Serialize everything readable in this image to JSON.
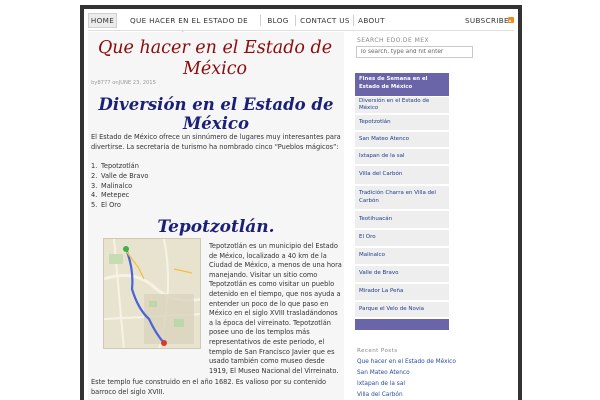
{
  "nav": {
    "items": [
      "Home",
      "Que hacer en el Estado de México",
      "Blog",
      "Contact us",
      "About"
    ],
    "subscribe": "Subscribe"
  },
  "post": {
    "title": "Que hacer en el Estado de México",
    "meta": "by8777 onJUNE 23, 2015",
    "heading": "Diversión en el Estado de México",
    "intro": "El Estado de México ofrece un sinnúmero de lugares muy interesantes para divertirse. La secretaria de turismo ha nombrado cinco “Pueblos mágicos”:",
    "list": [
      "Tepotzotlán",
      "Valle de Bravo",
      "Malinalco",
      "Metepec",
      "El Oro"
    ],
    "subheading": "Tepotzotlán.",
    "para": "Tepotzotlán es un municipio del Estado de México, localizado a 40 km de la Ciudad de México, a menos de una hora manejando. Visitar un sitio como Tepotzotlán es como visitar un pueblo detenido en el tiempo, que nos ayuda a entender un poco de lo que paso en México en el siglo XVIII trasladándonos a la época del virreinato. Tepotzotlán posee uno de los templos más representativos de este periodo, el templo de San Francisco Javier que es usado también como museo desde 1919, El Museo Nacional del Virreinato.",
    "para2": "Este templo fue construido en el año 1682. Es valioso por su contenido barroco del siglo XVIII."
  },
  "sidebar": {
    "search_label": "Search Edo.de Mex",
    "search_placeholder": "To search, type and hit enter",
    "menu_header": "Fines de Semana en el Estado de México",
    "menu_items": [
      "Diversión en el Estado de México",
      "Tepotzotlán",
      "San Mateo Atenco",
      "Ixtapan de la sal",
      "Villa del Carbón",
      "Tradición Charra en Villa del Carbón",
      "Teotihuacán",
      "El Oro",
      "Malinalco",
      "Valle de Bravo",
      "Mirador La Peña",
      "Parque el Velo de Novia"
    ],
    "recent_label": "Recent Posts",
    "recent_posts": [
      "Que hacer en el Estado de México",
      "San Mateo Atenco",
      "Ixtapan de la sal",
      "Villa del Carbón"
    ]
  },
  "colors": {
    "title_red": "#8b0b0b",
    "heading_blue": "#1a1f77",
    "menu_purple": "#6a64a8",
    "link_blue": "#1e3a8a"
  },
  "icons": [
    "rss-icon",
    "map-image"
  ]
}
